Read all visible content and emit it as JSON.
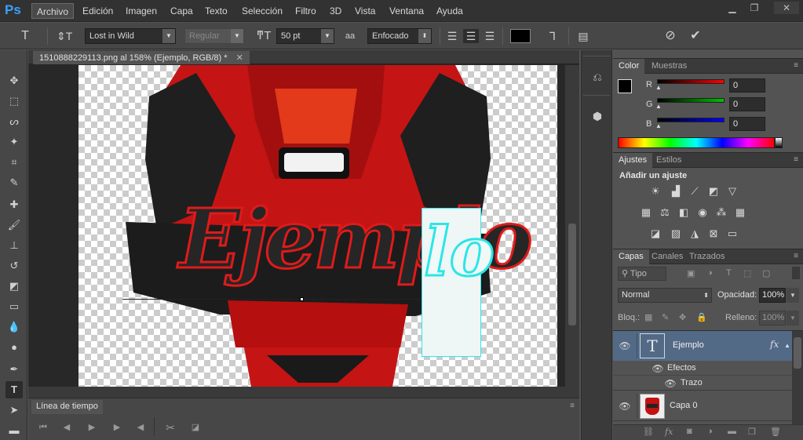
{
  "app": {
    "logo": "Ps"
  },
  "menu": [
    "Archivo",
    "Edición",
    "Imagen",
    "Capa",
    "Texto",
    "Selección",
    "Filtro",
    "3D",
    "Vista",
    "Ventana",
    "Ayuda"
  ],
  "window_controls": [
    "minimize-icon",
    "restore-icon",
    "close-icon"
  ],
  "options": {
    "font_family": "Lost in Wild",
    "font_style": "Regular",
    "font_size": "50 pt",
    "antialias_icon": "aa",
    "antialias": "Enfocado"
  },
  "document": {
    "tab_title": "1510888229113.png al 158% (Ejemplo, RGB/8) *",
    "canvas_text": "Ejemplo",
    "selection_text": "lo"
  },
  "timeline": {
    "title": "Línea de tiempo"
  },
  "color_panel": {
    "tabs": [
      "Color",
      "Muestras"
    ],
    "channels": [
      {
        "label": "R",
        "value": "0",
        "color": "#ff0000"
      },
      {
        "label": "G",
        "value": "0",
        "color": "#00c000"
      },
      {
        "label": "B",
        "value": "0",
        "color": "#0000ff"
      }
    ]
  },
  "adjust_panel": {
    "tabs": [
      "Ajustes",
      "Estilos"
    ],
    "heading": "Añadir un ajuste"
  },
  "layers_panel": {
    "tabs": [
      "Capas",
      "Canales",
      "Trazados"
    ],
    "filter_label": "Tipo",
    "blend_mode": "Normal",
    "opacity_label": "Opacidad:",
    "opacity": "100%",
    "lock_label": "Bloq.:",
    "fill_label": "Relleno:",
    "fill": "100%",
    "layers": [
      {
        "name": "Ejemplo",
        "type": "text",
        "fx": "fx",
        "effects_label": "Efectos",
        "effect": "Trazo"
      },
      {
        "name": "Capa 0",
        "type": "image"
      }
    ]
  },
  "colors": {
    "accent_selected_layer": "#536a86",
    "emblem_red": "#d01515",
    "emblem_dark": "#1e1e1e"
  }
}
